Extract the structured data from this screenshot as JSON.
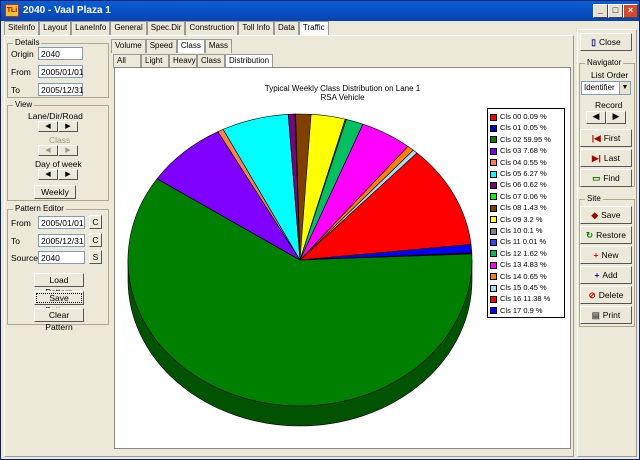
{
  "window": {
    "title": "2040 - Vaal Plaza 1",
    "app_icon": "TLi"
  },
  "main_tabs": [
    "SiteInfo",
    "Layout",
    "LaneInfo",
    "General",
    "Spec.Dir",
    "Construction",
    "Toll Info",
    "Data",
    "Traffic"
  ],
  "sub_tabs": [
    "Volume",
    "Speed",
    "Class",
    "Mass"
  ],
  "sub_sub_tabs": [
    "All",
    "Light",
    "Heavy",
    "Class",
    "Distribution"
  ],
  "details": {
    "legend": "Details",
    "origin_label": "Origin",
    "origin": "2040",
    "from_label": "From",
    "from": "2005/01/01",
    "to_label": "To",
    "to": "2005/12/31"
  },
  "view": {
    "legend": "View",
    "lane_label": "Lane/Dir/Road",
    "class_label": "Class",
    "dow_label": "Day of week",
    "weekly_button": "Weekly"
  },
  "pattern_editor": {
    "legend": "Pattern Editor",
    "from_label": "From",
    "from": "2005/01/01",
    "to_label": "To",
    "to": "2005/12/31",
    "source_label": "Source",
    "source": "2040",
    "c_label": "C",
    "s_label": "S",
    "load_button": "Load Pattern",
    "save_button": "Save Pattern",
    "clear_button": "Clear Pattern"
  },
  "right_panel": {
    "close": "Close",
    "navigator_legend": "Navigator",
    "list_order_label": "List Order",
    "list_order_value": "Identifier",
    "record_label": "Record",
    "first": "First",
    "last": "Last",
    "find": "Find",
    "site_legend": "Site",
    "save": "Save",
    "restore": "Restore",
    "new": "New",
    "add": "Add",
    "delete": "Delete",
    "print": "Print"
  },
  "chart_data": {
    "type": "pie",
    "title": "Typical Weekly Class Distribution on Lane 1",
    "subtitle": "RSA Vehicle",
    "legend_position": "right",
    "three_d": true,
    "slices": [
      {
        "label": "Cls 00 0.09 %",
        "value": 0.09,
        "color": "#ff0000"
      },
      {
        "label": "Cls 01 0.05 %",
        "value": 0.05,
        "color": "#0000cc"
      },
      {
        "label": "Cls 02 59.95 %",
        "value": 59.95,
        "color": "#008000"
      },
      {
        "label": "Cls 03 7.68 %",
        "value": 7.68,
        "color": "#8000ff"
      },
      {
        "label": "Cls 04 0.55 %",
        "value": 0.55,
        "color": "#ff8040"
      },
      {
        "label": "Cls 05 6.27 %",
        "value": 6.27,
        "color": "#00ffff"
      },
      {
        "label": "Cls 06 0.62 %",
        "value": 0.62,
        "color": "#800080"
      },
      {
        "label": "Cls 07 0.06 %",
        "value": 0.06,
        "color": "#00ff00"
      },
      {
        "label": "Cls 08 1.43 %",
        "value": 1.43,
        "color": "#804000"
      },
      {
        "label": "Cls 09 3.2 %",
        "value": 3.2,
        "color": "#ffff00"
      },
      {
        "label": "Cls 10 0.1 %",
        "value": 0.1,
        "color": "#808080"
      },
      {
        "label": "Cls 11 0.01 %",
        "value": 0.01,
        "color": "#4040ff"
      },
      {
        "label": "Cls 12 1.62 %",
        "value": 1.62,
        "color": "#00c060"
      },
      {
        "label": "Cls 13 4.83 %",
        "value": 4.83,
        "color": "#ff00ff"
      },
      {
        "label": "Cls 14 0.65 %",
        "value": 0.65,
        "color": "#ff8000"
      },
      {
        "label": "Cls 15 0.45 %",
        "value": 0.45,
        "color": "#a0e0ff"
      },
      {
        "label": "Cls 16 11.38 %",
        "value": 11.38,
        "color": "#ff0000"
      },
      {
        "label": "Cls 17 0.9 %",
        "value": 0.9,
        "color": "#0000ff"
      }
    ]
  }
}
